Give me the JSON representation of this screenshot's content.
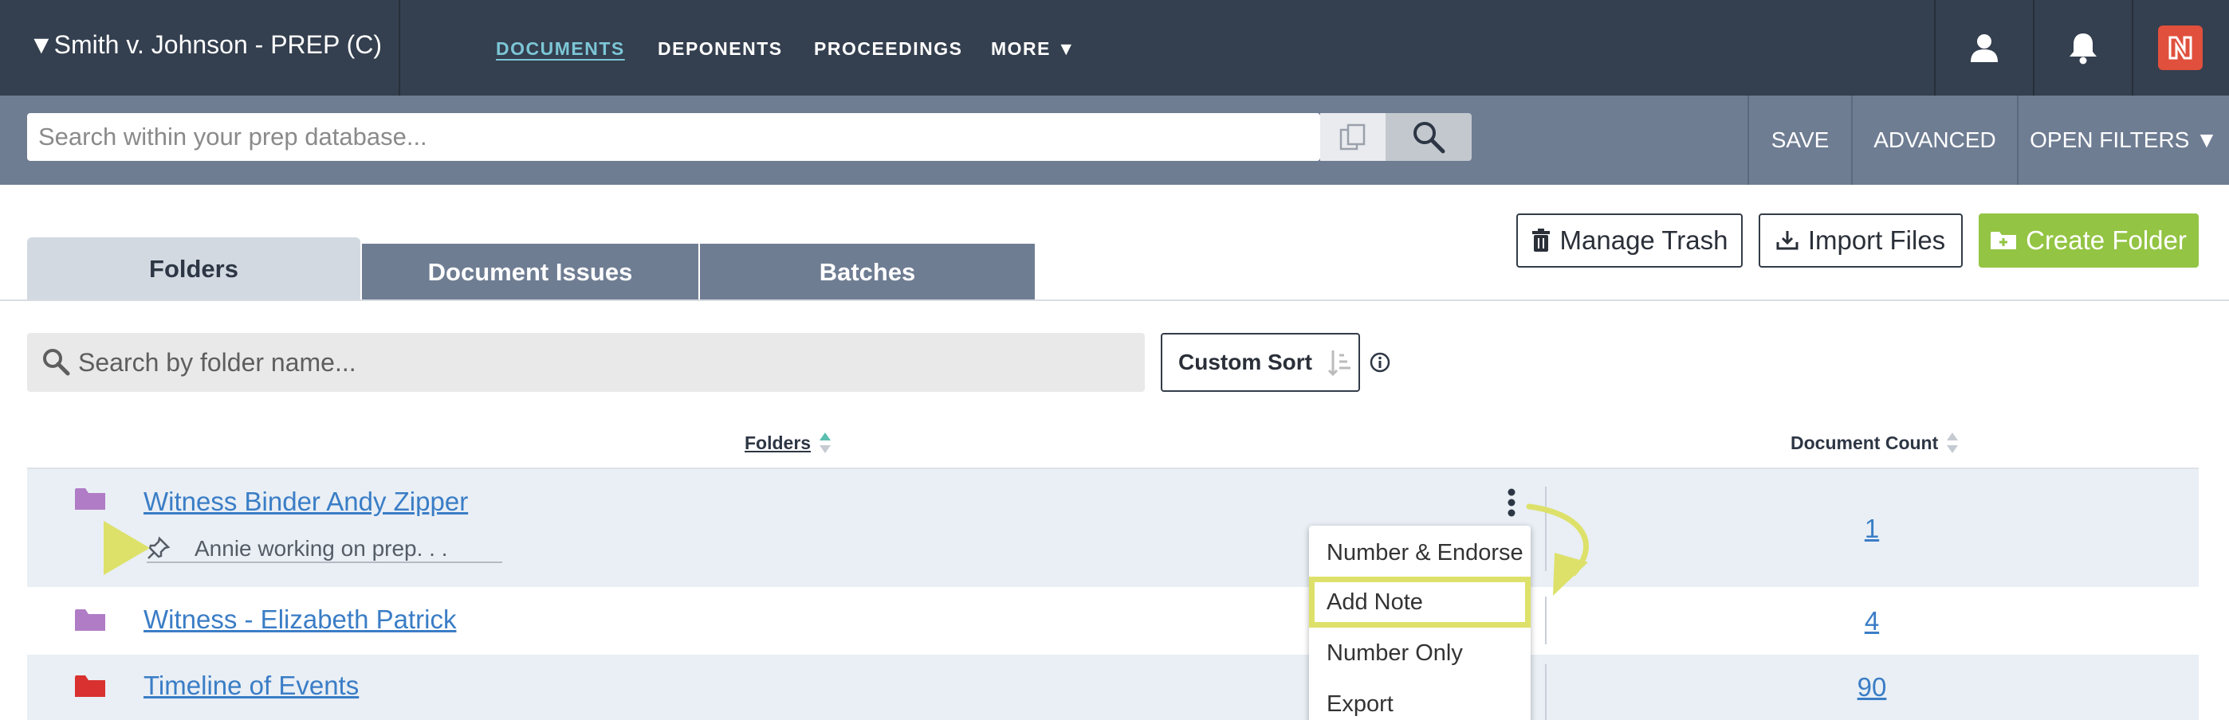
{
  "header": {
    "case_title": "▼Smith v. Johnson - PREP (C)",
    "nav": [
      "DOCUMENTS",
      "DEPONENTS",
      "PROCEEDINGS",
      "MORE ▼"
    ],
    "active_nav": "DOCUMENTS"
  },
  "search": {
    "placeholder": "Search within your prep database...",
    "save_label": "SAVE",
    "advanced_label": "ADVANCED",
    "open_filters_label": "OPEN FILTERS ▼"
  },
  "tabs": [
    {
      "label": "Folders",
      "active": true
    },
    {
      "label": "Document Issues",
      "active": false
    },
    {
      "label": "Batches",
      "active": false
    }
  ],
  "actions": {
    "manage_trash": "Manage Trash",
    "import_files": "Import Files",
    "create_folder": "Create Folder"
  },
  "folder_search": {
    "placeholder": "Search by folder name...",
    "sort_label": "Custom Sort"
  },
  "table": {
    "col_folders": "Folders",
    "col_count": "Document Count",
    "rows": [
      {
        "name": "Witness Binder Andy Zipper",
        "note": "Annie working on prep. . .",
        "count": "1",
        "icon_color": "#b07cc6"
      },
      {
        "name": "Witness - Elizabeth Patrick",
        "count": "4",
        "icon_color": "#b07cc6"
      },
      {
        "name": "Timeline of Events",
        "count": "90",
        "icon_color": "#d9312f"
      }
    ]
  },
  "context_menu": {
    "items": [
      "Number & Endorse",
      "Add Note",
      "Number Only",
      "Export"
    ],
    "highlighted": "Add Note"
  },
  "colors": {
    "nav_bg": "#343f4f",
    "search_bar_bg": "#6f7d93",
    "accent_link": "#3a7dc6",
    "create_button": "#93c443",
    "annotation_yellow": "#dde16a"
  }
}
